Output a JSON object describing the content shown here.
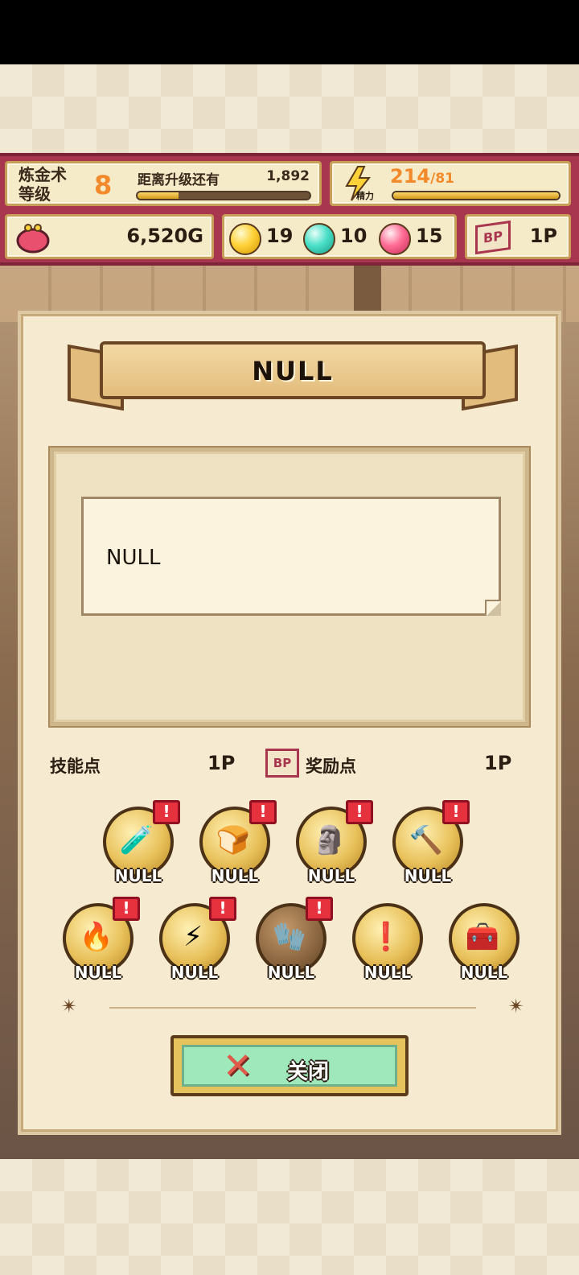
{
  "hud": {
    "alchemy_label": "炼金术\n等级",
    "level": "8",
    "next_label": "距离升级还有",
    "xp_remaining": "1,892",
    "xp_progress": 0.24,
    "energy_label": "精力",
    "energy_value": "214",
    "energy_max": "/81",
    "energy_progress": 1.0,
    "gold": "6,520G",
    "gems": {
      "yellow": "19",
      "cyan": "10",
      "pink": "15"
    },
    "bp_badge": "BP",
    "bp_value": "1P"
  },
  "dialog": {
    "title": "NULL",
    "description": "NULL",
    "skill_points_label": "技能点",
    "skill_points_value": "1P",
    "reward_points_badge": "BP",
    "reward_points_label": "奖励点",
    "reward_points_value": "1P",
    "skills_row1": [
      {
        "label": "NULL",
        "icon": "potion-icon",
        "glyph": "🧪",
        "alert": "!"
      },
      {
        "label": "NULL",
        "icon": "bread-icon",
        "glyph": "🍞",
        "alert": "!"
      },
      {
        "label": "NULL",
        "icon": "statue-icon",
        "glyph": "🗿",
        "alert": "!"
      },
      {
        "label": "NULL",
        "icon": "hammer-icon",
        "glyph": "🔨",
        "alert": "!"
      }
    ],
    "skills_row2": [
      {
        "label": "NULL",
        "icon": "fire-icon",
        "glyph": "🔥",
        "alert": "!"
      },
      {
        "label": "NULL",
        "icon": "lightning-icon",
        "glyph": "⚡",
        "alert": "!"
      },
      {
        "label": "NULL",
        "icon": "glove-icon",
        "glyph": "🧤",
        "alert": "!"
      },
      {
        "label": "NULL",
        "icon": "exclamation-icon",
        "glyph": "❗"
      },
      {
        "label": "NULL",
        "icon": "treasure-chest-icon",
        "glyph": "🧰"
      }
    ],
    "close_label": "关闭"
  }
}
